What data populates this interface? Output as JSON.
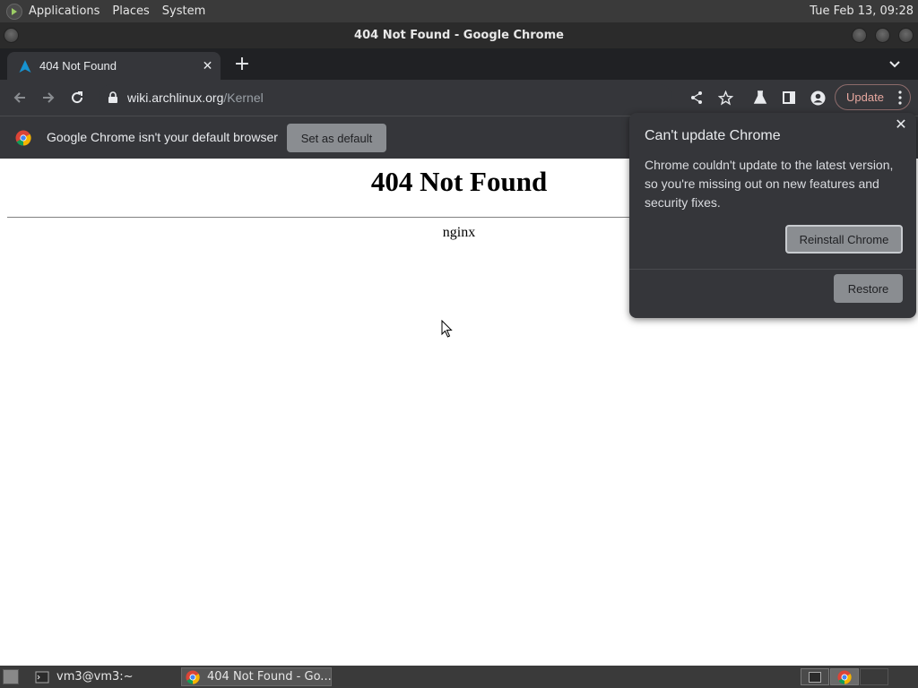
{
  "top_panel": {
    "menus": [
      "Applications",
      "Places",
      "System"
    ],
    "clock": "Tue Feb 13, 09:28"
  },
  "window": {
    "title": "404 Not Found - Google Chrome"
  },
  "tabs": [
    {
      "title": "404 Not Found",
      "favicon": "arch-linux-icon",
      "active": true
    }
  ],
  "toolbar": {
    "url_domain": "wiki.archlinux.org",
    "url_path": "/Kernel",
    "update_label": "Update"
  },
  "infobar": {
    "message": "Google Chrome isn't your default browser",
    "button": "Set as default"
  },
  "page": {
    "heading": "404 Not Found",
    "server": "nginx"
  },
  "update_bubble": {
    "title": "Can't update Chrome",
    "body": "Chrome couldn't update to the latest version, so you're missing out on new features and security fixes.",
    "primary_button": "Reinstall Chrome",
    "secondary_button": "Restore"
  },
  "taskbar": {
    "tasks": [
      {
        "label": "vm3@vm3:~",
        "icon": "terminal-icon",
        "active": false
      },
      {
        "label": "404 Not Found - Go...",
        "icon": "chrome-icon",
        "active": true
      }
    ]
  },
  "colors": {
    "panel_bg": "#3a3a3a",
    "chrome_dark": "#35363a",
    "tabstrip_bg": "#202124",
    "update_accent": "#e8a8a0",
    "button_grey": "#8a8d91"
  }
}
